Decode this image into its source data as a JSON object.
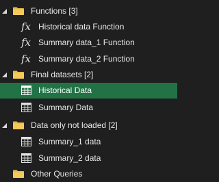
{
  "queries_pane": {
    "groups": [
      {
        "label": "Functions [3]",
        "icon": "folder-icon",
        "items": [
          {
            "label": "Historical data Function",
            "icon": "fx-icon"
          },
          {
            "label": "Summary data_1 Function",
            "icon": "fx-icon"
          },
          {
            "label": "Summary data_2 Function",
            "icon": "fx-icon"
          }
        ]
      },
      {
        "label": "Final datasets [2]",
        "icon": "folder-icon",
        "items": [
          {
            "label": "Historical Data",
            "icon": "table-icon",
            "selected": true
          },
          {
            "label": "Summary Data",
            "icon": "table-icon"
          }
        ]
      },
      {
        "label": "Data only not loaded [2]",
        "icon": "folder-icon",
        "items": [
          {
            "label": "Summary_1 data",
            "icon": "table-icon"
          },
          {
            "label": "Summary_2 data",
            "icon": "table-icon"
          }
        ]
      },
      {
        "label": "Other Queries",
        "icon": "folder-icon",
        "items": []
      }
    ],
    "colors": {
      "background": "#1f1f1f",
      "selected_row": "#217346",
      "folder": "#e8b84a",
      "text": "#e8e8e8"
    }
  }
}
